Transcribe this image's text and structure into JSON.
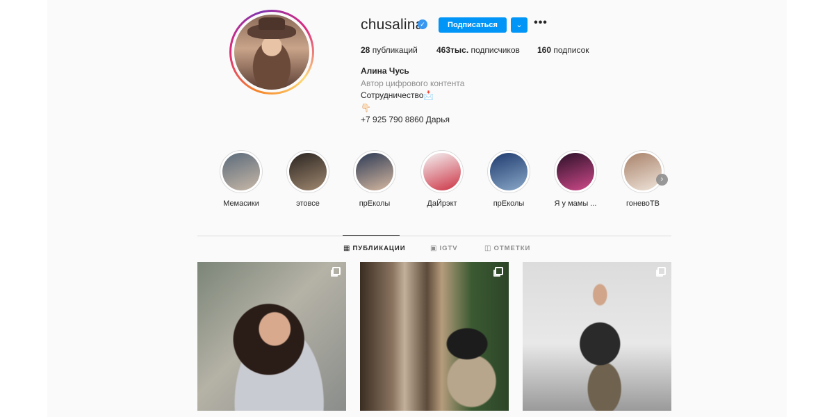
{
  "profile": {
    "username": "chusalina",
    "verified": true,
    "follow_label": "Подписаться",
    "more_label": "•••",
    "dropdown_label": "⌄"
  },
  "stats": {
    "posts": "28",
    "posts_label": "публикаций",
    "followers": "463тыс.",
    "followers_label": "подписчиков",
    "following": "160",
    "following_label": "подписок"
  },
  "bio": {
    "name": "Алина Чусь",
    "category": "Автор цифрового контента",
    "line1": "Сотрудничество📩",
    "line2": "👇🏻",
    "line3": "+7 925 790 8860 Дарья"
  },
  "highlights": [
    {
      "label": "Мемасики",
      "colors": [
        "#5a6a7a",
        "#c8b8a8"
      ]
    },
    {
      "label": "этовсе",
      "colors": [
        "#2a2420",
        "#a08870"
      ]
    },
    {
      "label": "прЕколы",
      "colors": [
        "#2c3a55",
        "#d6b8a0"
      ]
    },
    {
      "label": "ДаЙрэкт",
      "colors": [
        "#f4f4f4",
        "#cc3344"
      ]
    },
    {
      "label": "прЕколы",
      "colors": [
        "#1e3a6e",
        "#8aa8c8"
      ]
    },
    {
      "label": "Я у мамы ...",
      "colors": [
        "#2a1028",
        "#d04a8a"
      ]
    },
    {
      "label": "гоневоТВ",
      "colors": [
        "#a8826a",
        "#efe4da"
      ]
    }
  ],
  "tabs": {
    "posts": "ПУБЛИКАЦИИ",
    "igtv": "IGTV",
    "tagged": "ОТМЕТКИ"
  },
  "accent_color": "#0095f6"
}
